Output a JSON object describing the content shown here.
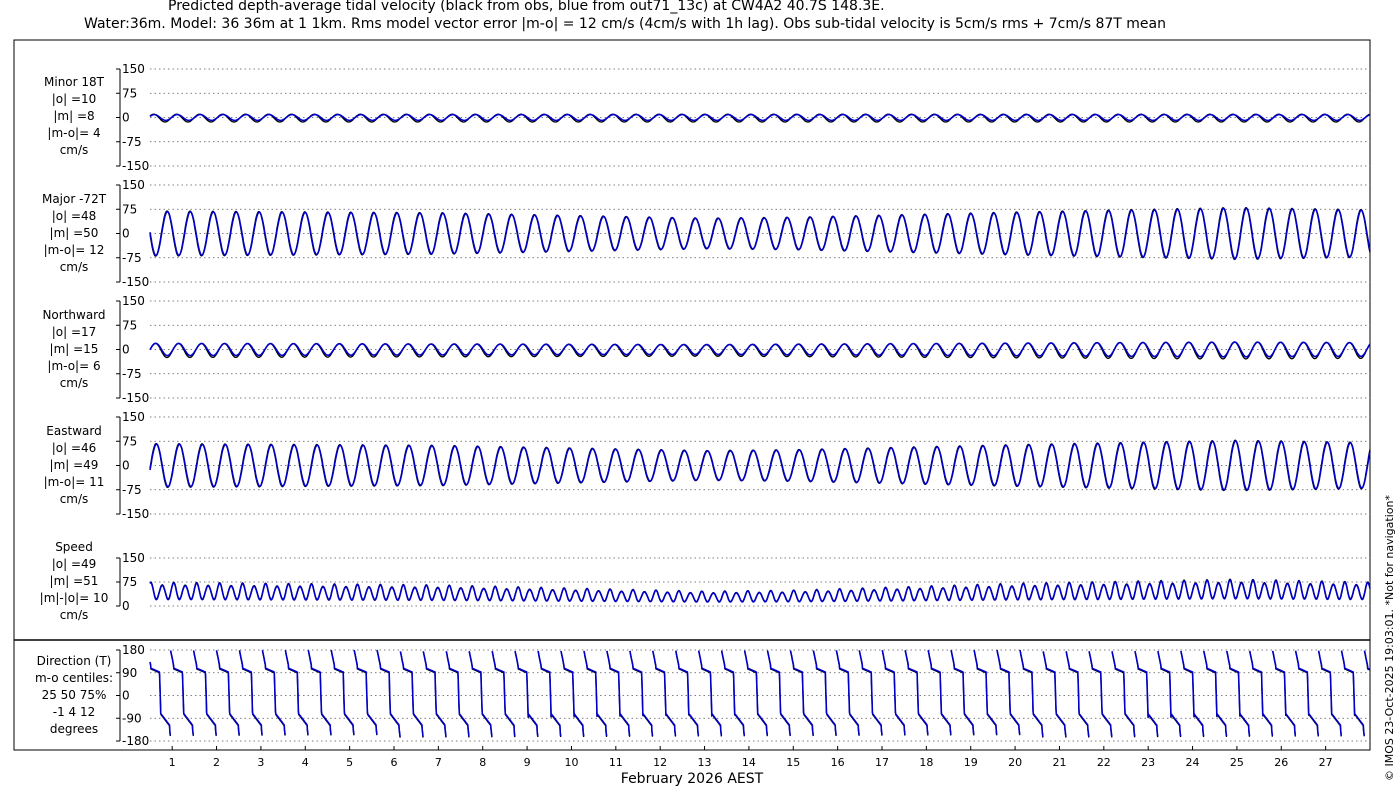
{
  "title_line1": "Predicted depth-average tidal velocity (black from obs, blue from out71_13c) at CW4A2 40.7S 148.3E.",
  "title_line2": "Water:36m. Model: 36 36m at 1 1km. Rms model vector error |m-o| = 12 cm/s (4cm/s with 1h lag). Obs sub-tidal velocity is 5cm/s rms + 7cm/s 87T mean",
  "xlabel": "February 2026 AEST",
  "credit": "© IMOS 23-Oct-2025 19:03:01. *Not for navigation*",
  "colors": {
    "obs": "#000000",
    "model": "#0000c8"
  },
  "chart_data": [
    {
      "type": "line",
      "panel": "minor",
      "label_lines": [
        "Minor 18T",
        "|o| =10",
        "|m| =8",
        "|m-o|= 4",
        "cm/s"
      ],
      "ylim": [
        -150,
        150
      ],
      "yticks": [
        150,
        75,
        0,
        -75,
        -150
      ],
      "x_range_days": [
        0.5,
        28.0
      ],
      "xticks": [
        1,
        2,
        3,
        4,
        5,
        6,
        7,
        8,
        9,
        10,
        11,
        12,
        13,
        14,
        15,
        16,
        17,
        18,
        19,
        20,
        21,
        22,
        23,
        24,
        25,
        26,
        27
      ],
      "grid": true,
      "series": [
        {
          "role": "obs",
          "amplitude": 12,
          "period_days": 0.5175,
          "phase": 0.8,
          "mean": -2
        },
        {
          "role": "model",
          "amplitude": 9,
          "period_days": 0.5175,
          "phase": 0.6,
          "mean": 0
        }
      ]
    },
    {
      "type": "line",
      "panel": "major",
      "label_lines": [
        "Major -72T",
        "|o| =48",
        "|m| =50",
        "|m-o|= 12",
        "cm/s"
      ],
      "ylim": [
        -150,
        150
      ],
      "yticks": [
        150,
        75,
        0,
        -75,
        -150
      ],
      "x_range_days": [
        0.5,
        28.0
      ],
      "grid": true,
      "series": [
        {
          "role": "obs",
          "amplitude": 70,
          "period_days": 0.5175,
          "phase": 3.4,
          "mean": 0,
          "envelope": [
            [
              0.5,
              1.0
            ],
            [
              7,
              0.92
            ],
            [
              13,
              0.68
            ],
            [
              15,
              0.72
            ],
            [
              20,
              0.95
            ],
            [
              25,
              1.15
            ],
            [
              28,
              1.05
            ]
          ]
        },
        {
          "role": "model",
          "amplitude": 68,
          "period_days": 0.5175,
          "phase": 3.3,
          "mean": 0,
          "envelope": [
            [
              0.5,
              1.0
            ],
            [
              7,
              0.92
            ],
            [
              13,
              0.68
            ],
            [
              15,
              0.72
            ],
            [
              20,
              0.95
            ],
            [
              25,
              1.15
            ],
            [
              28,
              1.05
            ]
          ]
        }
      ]
    },
    {
      "type": "line",
      "panel": "northward",
      "label_lines": [
        "Northward",
        "|o| =17",
        "|m| =15",
        "|m-o|= 6",
        "cm/s"
      ],
      "ylim": [
        -150,
        150
      ],
      "yticks": [
        150,
        75,
        0,
        -75,
        -150
      ],
      "x_range_days": [
        0.5,
        28.0
      ],
      "grid": true,
      "series": [
        {
          "role": "obs",
          "amplitude": 22,
          "period_days": 0.5175,
          "phase": 0.3,
          "mean": -3,
          "envelope": [
            [
              0.5,
              1.0
            ],
            [
              13,
              0.8
            ],
            [
              25,
              1.2
            ],
            [
              28,
              1.1
            ]
          ]
        },
        {
          "role": "model",
          "amplitude": 19,
          "period_days": 0.5175,
          "phase": 0.2,
          "mean": 0,
          "envelope": [
            [
              0.5,
              1.0
            ],
            [
              13,
              0.8
            ],
            [
              25,
              1.2
            ],
            [
              28,
              1.1
            ]
          ]
        }
      ]
    },
    {
      "type": "line",
      "panel": "eastward",
      "label_lines": [
        "Eastward",
        "|o| =46",
        "|m| =49",
        "|m-o|= 11",
        "cm/s"
      ],
      "ylim": [
        -150,
        150
      ],
      "yticks": [
        150,
        75,
        0,
        -75,
        -150
      ],
      "x_range_days": [
        0.5,
        28.0
      ],
      "grid": true,
      "series": [
        {
          "role": "obs",
          "amplitude": 68,
          "period_days": 0.5175,
          "phase": 0.1,
          "mean": 0,
          "envelope": [
            [
              0.5,
              1.0
            ],
            [
              7,
              0.92
            ],
            [
              13,
              0.68
            ],
            [
              15,
              0.72
            ],
            [
              20,
              0.95
            ],
            [
              25,
              1.15
            ],
            [
              28,
              1.05
            ]
          ]
        },
        {
          "role": "model",
          "amplitude": 66,
          "period_days": 0.5175,
          "phase": 0.0,
          "mean": 0,
          "envelope": [
            [
              0.5,
              1.0
            ],
            [
              7,
              0.92
            ],
            [
              13,
              0.68
            ],
            [
              15,
              0.72
            ],
            [
              20,
              0.95
            ],
            [
              25,
              1.15
            ],
            [
              28,
              1.05
            ]
          ]
        }
      ]
    },
    {
      "type": "line",
      "panel": "speed",
      "label_lines": [
        "Speed",
        "|o| =49",
        "|m| =51",
        "|m|-|o|= 10",
        "cm/s"
      ],
      "ylim": [
        0,
        150
      ],
      "yticks": [
        150,
        75,
        0
      ],
      "x_range_days": [
        0.5,
        28.0
      ],
      "grid": true,
      "series": [
        {
          "role": "obs",
          "min": 18,
          "max": 75,
          "period_days": 0.2588,
          "envelope": [
            [
              0.5,
              1.0
            ],
            [
              7,
              0.88
            ],
            [
              13,
              0.62
            ],
            [
              15,
              0.66
            ],
            [
              20,
              0.95
            ],
            [
              25,
              1.12
            ],
            [
              28,
              1.0
            ]
          ]
        },
        {
          "role": "model",
          "min": 16,
          "max": 73,
          "period_days": 0.2588,
          "envelope": [
            [
              0.5,
              1.0
            ],
            [
              7,
              0.88
            ],
            [
              13,
              0.62
            ],
            [
              15,
              0.66
            ],
            [
              20,
              0.95
            ],
            [
              25,
              1.12
            ],
            [
              28,
              1.0
            ]
          ]
        }
      ]
    },
    {
      "type": "line",
      "panel": "direction",
      "label_lines": [
        "Direction (T)",
        "m-o centiles:",
        "25  50  75%",
        "-1   4  12",
        "degrees"
      ],
      "ylim": [
        -180,
        180
      ],
      "yticks": [
        180,
        90,
        0,
        -90,
        -180
      ],
      "x_range_days": [
        0.5,
        28.0
      ],
      "grid": true,
      "series": [
        {
          "role": "obs",
          "plateau_high": 105,
          "plateau_low": -75,
          "period_days": 0.5175,
          "wrap": true
        },
        {
          "role": "model",
          "plateau_high": 108,
          "plateau_low": -72,
          "period_days": 0.5175,
          "wrap": true
        }
      ]
    }
  ]
}
